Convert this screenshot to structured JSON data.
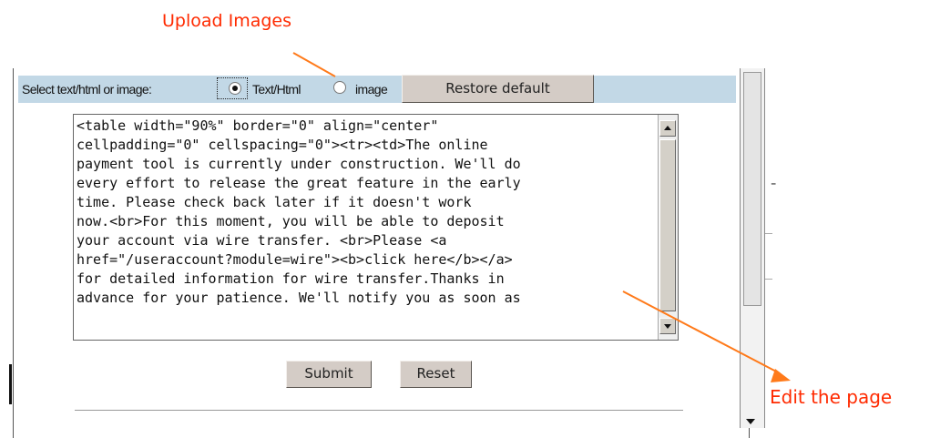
{
  "annotations": {
    "upload_images": "Upload Images",
    "edit_the_page": "Edit the page"
  },
  "toolbar": {
    "label": "Select text/html or image:",
    "option_text_html": "Text/Html",
    "option_image": "image",
    "selected_option": "Text/Html",
    "restore_label": "Restore default"
  },
  "editor": {
    "content": "<table width=\"90%\" border=\"0\" align=\"center\"\ncellpadding=\"0\" cellspacing=\"0\"><tr><td>The online\npayment tool is currently under construction. We'll do\nevery effort to release the great feature in the early\ntime. Please check back later if it doesn't work\nnow.<br>For this moment, you will be able to deposit\nyour account via wire transfer. <br>Please <a\nhref=\"/useraccount?module=wire\"><b>click here</b></a>\nfor detailed information for wire transfer.Thanks in\nadvance for your patience. We'll notify you as soon as"
  },
  "buttons": {
    "submit": "Submit",
    "reset": "Reset"
  },
  "colors": {
    "annotation": "#ff2a00",
    "toolbar_bg": "#c2d8e6",
    "button_bg": "#d4ccc6"
  },
  "icons": [
    "scroll-up-arrow-icon",
    "scroll-down-arrow-icon",
    "annotation-arrow-icon"
  ]
}
